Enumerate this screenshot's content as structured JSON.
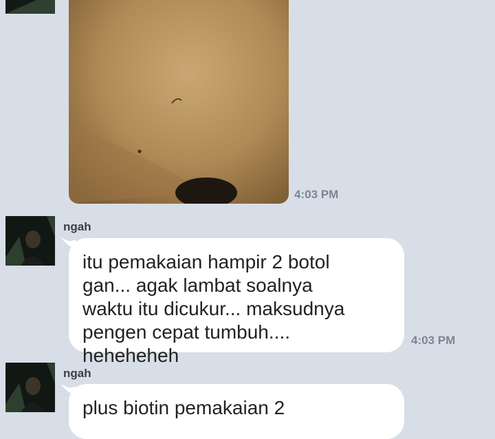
{
  "messages": [
    {
      "type": "image",
      "time": "4:03 PM"
    },
    {
      "type": "text",
      "sender": "ngah",
      "text": "itu pemakaian hampir 2 botol gan... agak lambat soalnya waktu itu dicukur... maksudnya pengen cepat tumbuh.... heheheheh",
      "time": "4:03 PM"
    },
    {
      "type": "text",
      "sender": "ngah",
      "text": "plus biotin pemakaian 2"
    }
  ],
  "icons": {
    "avatar": "profile-photo-avatar"
  },
  "colors": {
    "background": "#d8dee7",
    "bubble": "#ffffff",
    "timestamp": "#7d8591",
    "sender": "#3a3f47"
  }
}
